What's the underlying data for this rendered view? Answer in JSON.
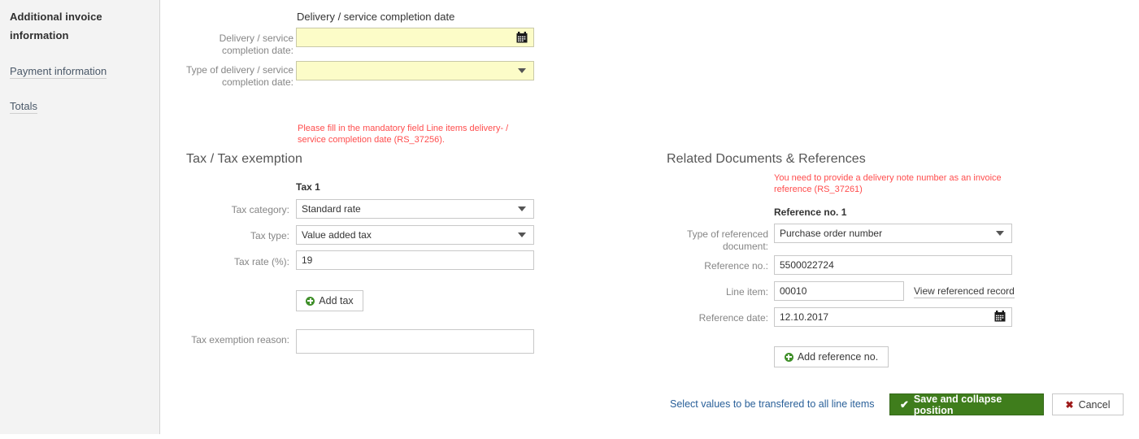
{
  "sidebar": {
    "heading": "Additional invoice information",
    "items": [
      {
        "label": "Payment information"
      },
      {
        "label": "Totals"
      }
    ]
  },
  "delivery_section": {
    "title": "Delivery / service completion date",
    "fields": [
      {
        "label": "Delivery / service completion date:",
        "value": "",
        "type": "date",
        "highlight": true
      },
      {
        "label": "Type of delivery / service completion date:",
        "value": "",
        "type": "select",
        "highlight": true
      }
    ],
    "error": "Please fill in the mandatory field Line items delivery- / service completion date (RS_37256)."
  },
  "tax_section": {
    "title": "Tax / Tax exemption",
    "group_label": "Tax 1",
    "fields": [
      {
        "label": "Tax category:",
        "value": "Standard rate",
        "type": "select"
      },
      {
        "label": "Tax type:",
        "value": "Value added tax",
        "type": "select"
      },
      {
        "label": "Tax rate (%):",
        "value": "19",
        "type": "text"
      }
    ],
    "add_button": "Add tax",
    "exemption_label": "Tax exemption reason:",
    "exemption_value": ""
  },
  "references_section": {
    "title": "Related Documents & References",
    "error": "You need to provide a delivery note number as an invoice reference (RS_37261)",
    "group_label": "Reference no. 1",
    "fields": [
      {
        "label": "Type of referenced document:",
        "value": "Purchase order number",
        "type": "select"
      },
      {
        "label": "Reference no.:",
        "value": "5500022724",
        "type": "text"
      },
      {
        "label": "Line item:",
        "value": "00010",
        "type": "text"
      },
      {
        "label": "Reference date:",
        "value": "12.10.2017",
        "type": "date"
      }
    ],
    "view_record_link": "View referenced record",
    "add_button": "Add reference no."
  },
  "footer": {
    "transfer_link": "Select values to be transfered to all line items",
    "save_label": "Save and collapse position",
    "cancel_label": "Cancel",
    "check_glyph": "✔",
    "cross_glyph": "✖"
  },
  "icons": {
    "calendar": "📅"
  },
  "colors": {
    "accent_green": "#3f7d1c",
    "error_red": "#ff4d4d",
    "link_blue": "#2a6099",
    "field_yellow": "#fcfcc8"
  }
}
